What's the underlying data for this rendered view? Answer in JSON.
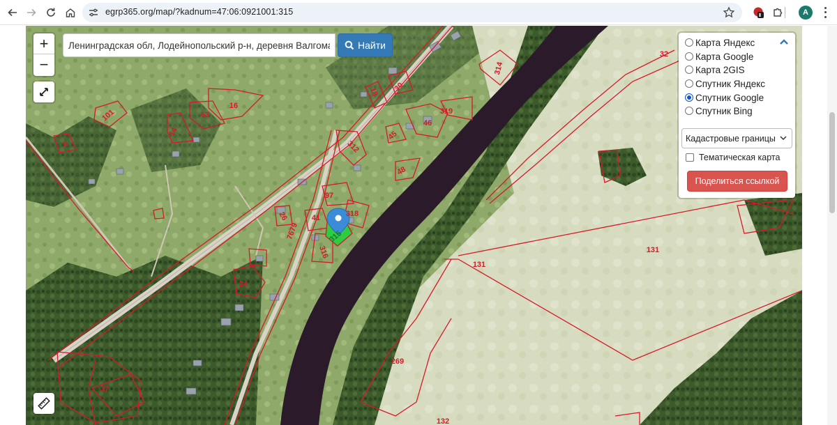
{
  "browser": {
    "url": "egrp365.org/map/?kadnum=47:06:0921001:315",
    "profile_initial": "A"
  },
  "map": {
    "search": {
      "value": "Ленинградская обл, Лодейнопольский р-н, деревня Валгома",
      "button_label": "Найти"
    },
    "zoom_in": "+",
    "zoom_out": "−",
    "layers": [
      {
        "label": "Карта Яндекс",
        "selected": false
      },
      {
        "label": "Карта Google",
        "selected": false
      },
      {
        "label": "Карта 2GIS",
        "selected": false
      },
      {
        "label": "Спутник Яндекс",
        "selected": false
      },
      {
        "label": "Спутник Google",
        "selected": true
      },
      {
        "label": "Спутник Bing",
        "selected": false
      }
    ],
    "overlay_select": "Кадастровые границы",
    "thematic_checkbox": "Тематическая карта",
    "share_button": "Поделиться ссылкой",
    "parcel_labels": {
      "p101": "101",
      "p16": "16",
      "p63": "63",
      "p14": "14",
      "p6": "6",
      "p18": "18",
      "p30": "30",
      "p314": "314",
      "p32": "32",
      "p319": "319",
      "p46": "46",
      "p45": "45",
      "p312": "312",
      "p48": "48",
      "p97": "97",
      "p318": "318",
      "p41": "41",
      "p26": "26",
      "p7679": "7679",
      "p315": "315",
      "p316": "316",
      "p24": "24",
      "p37": "37",
      "p131a": "131",
      "p131b": "131",
      "p269": "269",
      "p132": "132"
    },
    "colors": {
      "parcel_border": "#d51a2b",
      "selected_parcel": "#2ecc40",
      "river": "#2b1a2a",
      "marker": "#3a8bd8"
    }
  }
}
